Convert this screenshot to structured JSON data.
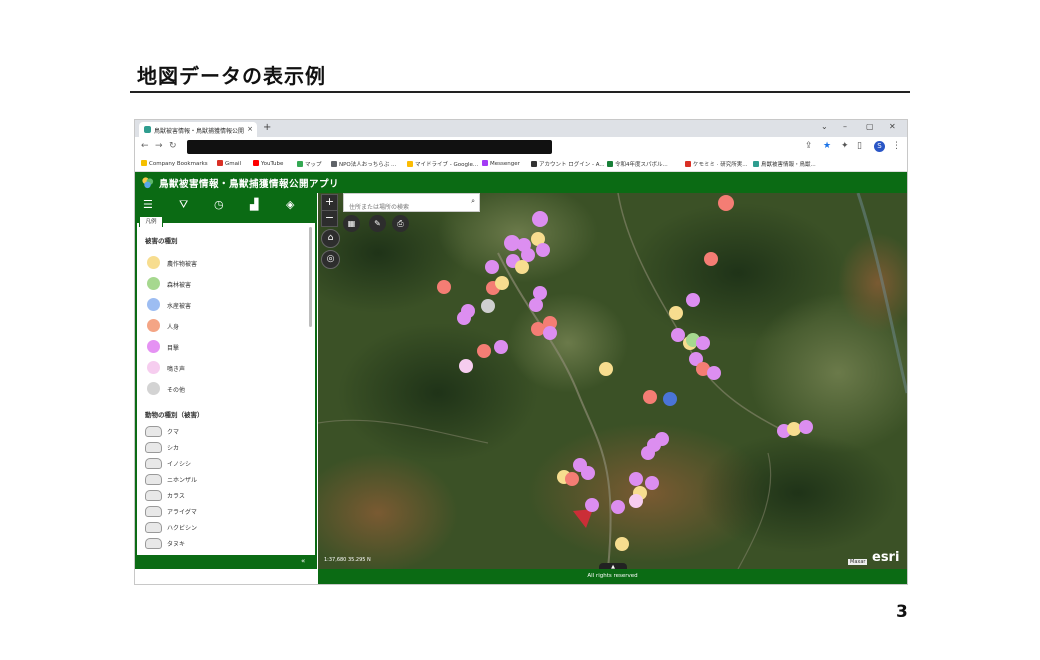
{
  "slide": {
    "title": "地図データの表示例",
    "page_number": "3"
  },
  "browser": {
    "tab_title": "鳥獣被害情報・鳥獣捕獲情報公開",
    "tab_close": "×",
    "new_tab": "+",
    "controls": [
      "⌄",
      "–",
      "▢",
      "✕"
    ],
    "profile_initial": "S",
    "bookmarks": [
      {
        "label": "Company Bookmarks",
        "color": "#f5c000"
      },
      {
        "label": "Gmail",
        "color": "#d93025"
      },
      {
        "label": "YouTube",
        "color": "#ff0000"
      },
      {
        "label": "マップ",
        "color": "#34a853"
      },
      {
        "label": "NPO法人おっちらぶ ...",
        "color": "#5f6368"
      },
      {
        "label": "マイドライブ - Google...",
        "color": "#fbbc04"
      },
      {
        "label": "Messenger",
        "color": "#a33bf5"
      },
      {
        "label": "アカウント ログイン - A...",
        "color": "#333333"
      },
      {
        "label": "令和4年度スパボル...",
        "color": "#188038"
      },
      {
        "label": "ケモミミ · 研究所実...",
        "color": "#d93025"
      },
      {
        "label": "鳥獣被害情報・鳥獣...",
        "color": "#2f9d8f"
      }
    ]
  },
  "app": {
    "title": "鳥獣被害情報・鳥獣捕獲情報公開アプリ",
    "legend_tab": "凡例",
    "damage_heading": "被害の種別",
    "damage_types": [
      {
        "label": "農作物被害",
        "color": "#f7dd8f"
      },
      {
        "label": "森林被害",
        "color": "#a6d88f"
      },
      {
        "label": "水産被害",
        "color": "#9dbdf2"
      },
      {
        "label": "人身",
        "color": "#f4a585"
      },
      {
        "label": "目撃",
        "color": "#e592f3"
      },
      {
        "label": "鳴き声",
        "color": "#f6cdef"
      },
      {
        "label": "その他",
        "color": "#d3d3d3"
      }
    ],
    "animal_heading": "動物の種別（被害）",
    "animals": [
      "クマ",
      "シカ",
      "イノシシ",
      "ニホンザル",
      "カラス",
      "アライグマ",
      "ハクビシン",
      "タヌキ"
    ],
    "search_placeholder": "住所または場所の検索",
    "scale_text": "1:37,680  35.295 N",
    "attribution": "All rights reserved",
    "esri": "esri",
    "maxar": "Maxar",
    "collapse": "«",
    "attr_toggle": "▲"
  },
  "map_colors": {
    "yellow": "#f7dd8f",
    "green": "#a6d88f",
    "blue": "#4a74d8",
    "salmon": "#f47d74",
    "purple": "#dc8ef0",
    "pink": "#f6cdef",
    "gray": "#cfcfcf"
  }
}
